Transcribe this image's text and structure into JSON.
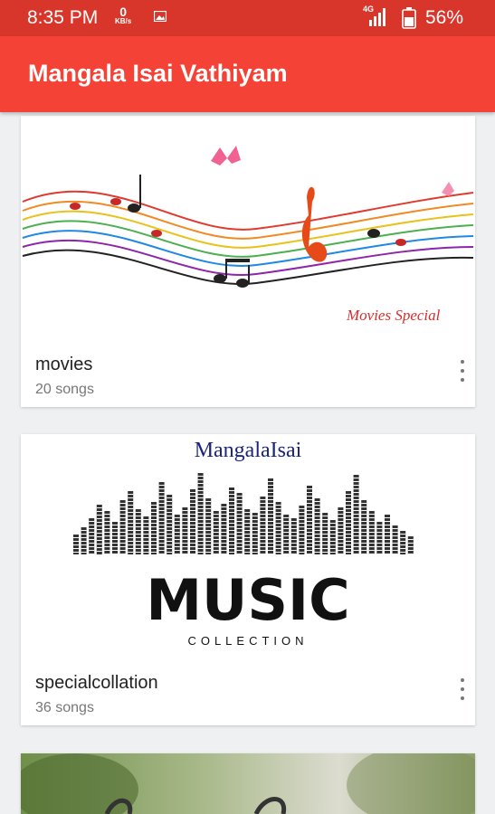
{
  "status_bar": {
    "time": "8:35 PM",
    "net_speed_value": "0",
    "net_speed_unit": "KB/s",
    "network_type": "4G",
    "battery": "56%",
    "icons": [
      "gallery-icon",
      "signal-icon",
      "battery-icon"
    ]
  },
  "app_bar": {
    "title": "Mangala Isai Vathiyam",
    "color": "#f44336",
    "status_color": "#d8362b"
  },
  "playlists": [
    {
      "name": "movies",
      "count": "20 songs",
      "image_caption": "Movies Special"
    },
    {
      "name": "specialcollation",
      "count": "36 songs",
      "image_brand": "MangalaIsai",
      "image_title": "MUSIC",
      "image_subtitle": "COLLECTION"
    },
    {
      "name": "",
      "count": ""
    }
  ]
}
